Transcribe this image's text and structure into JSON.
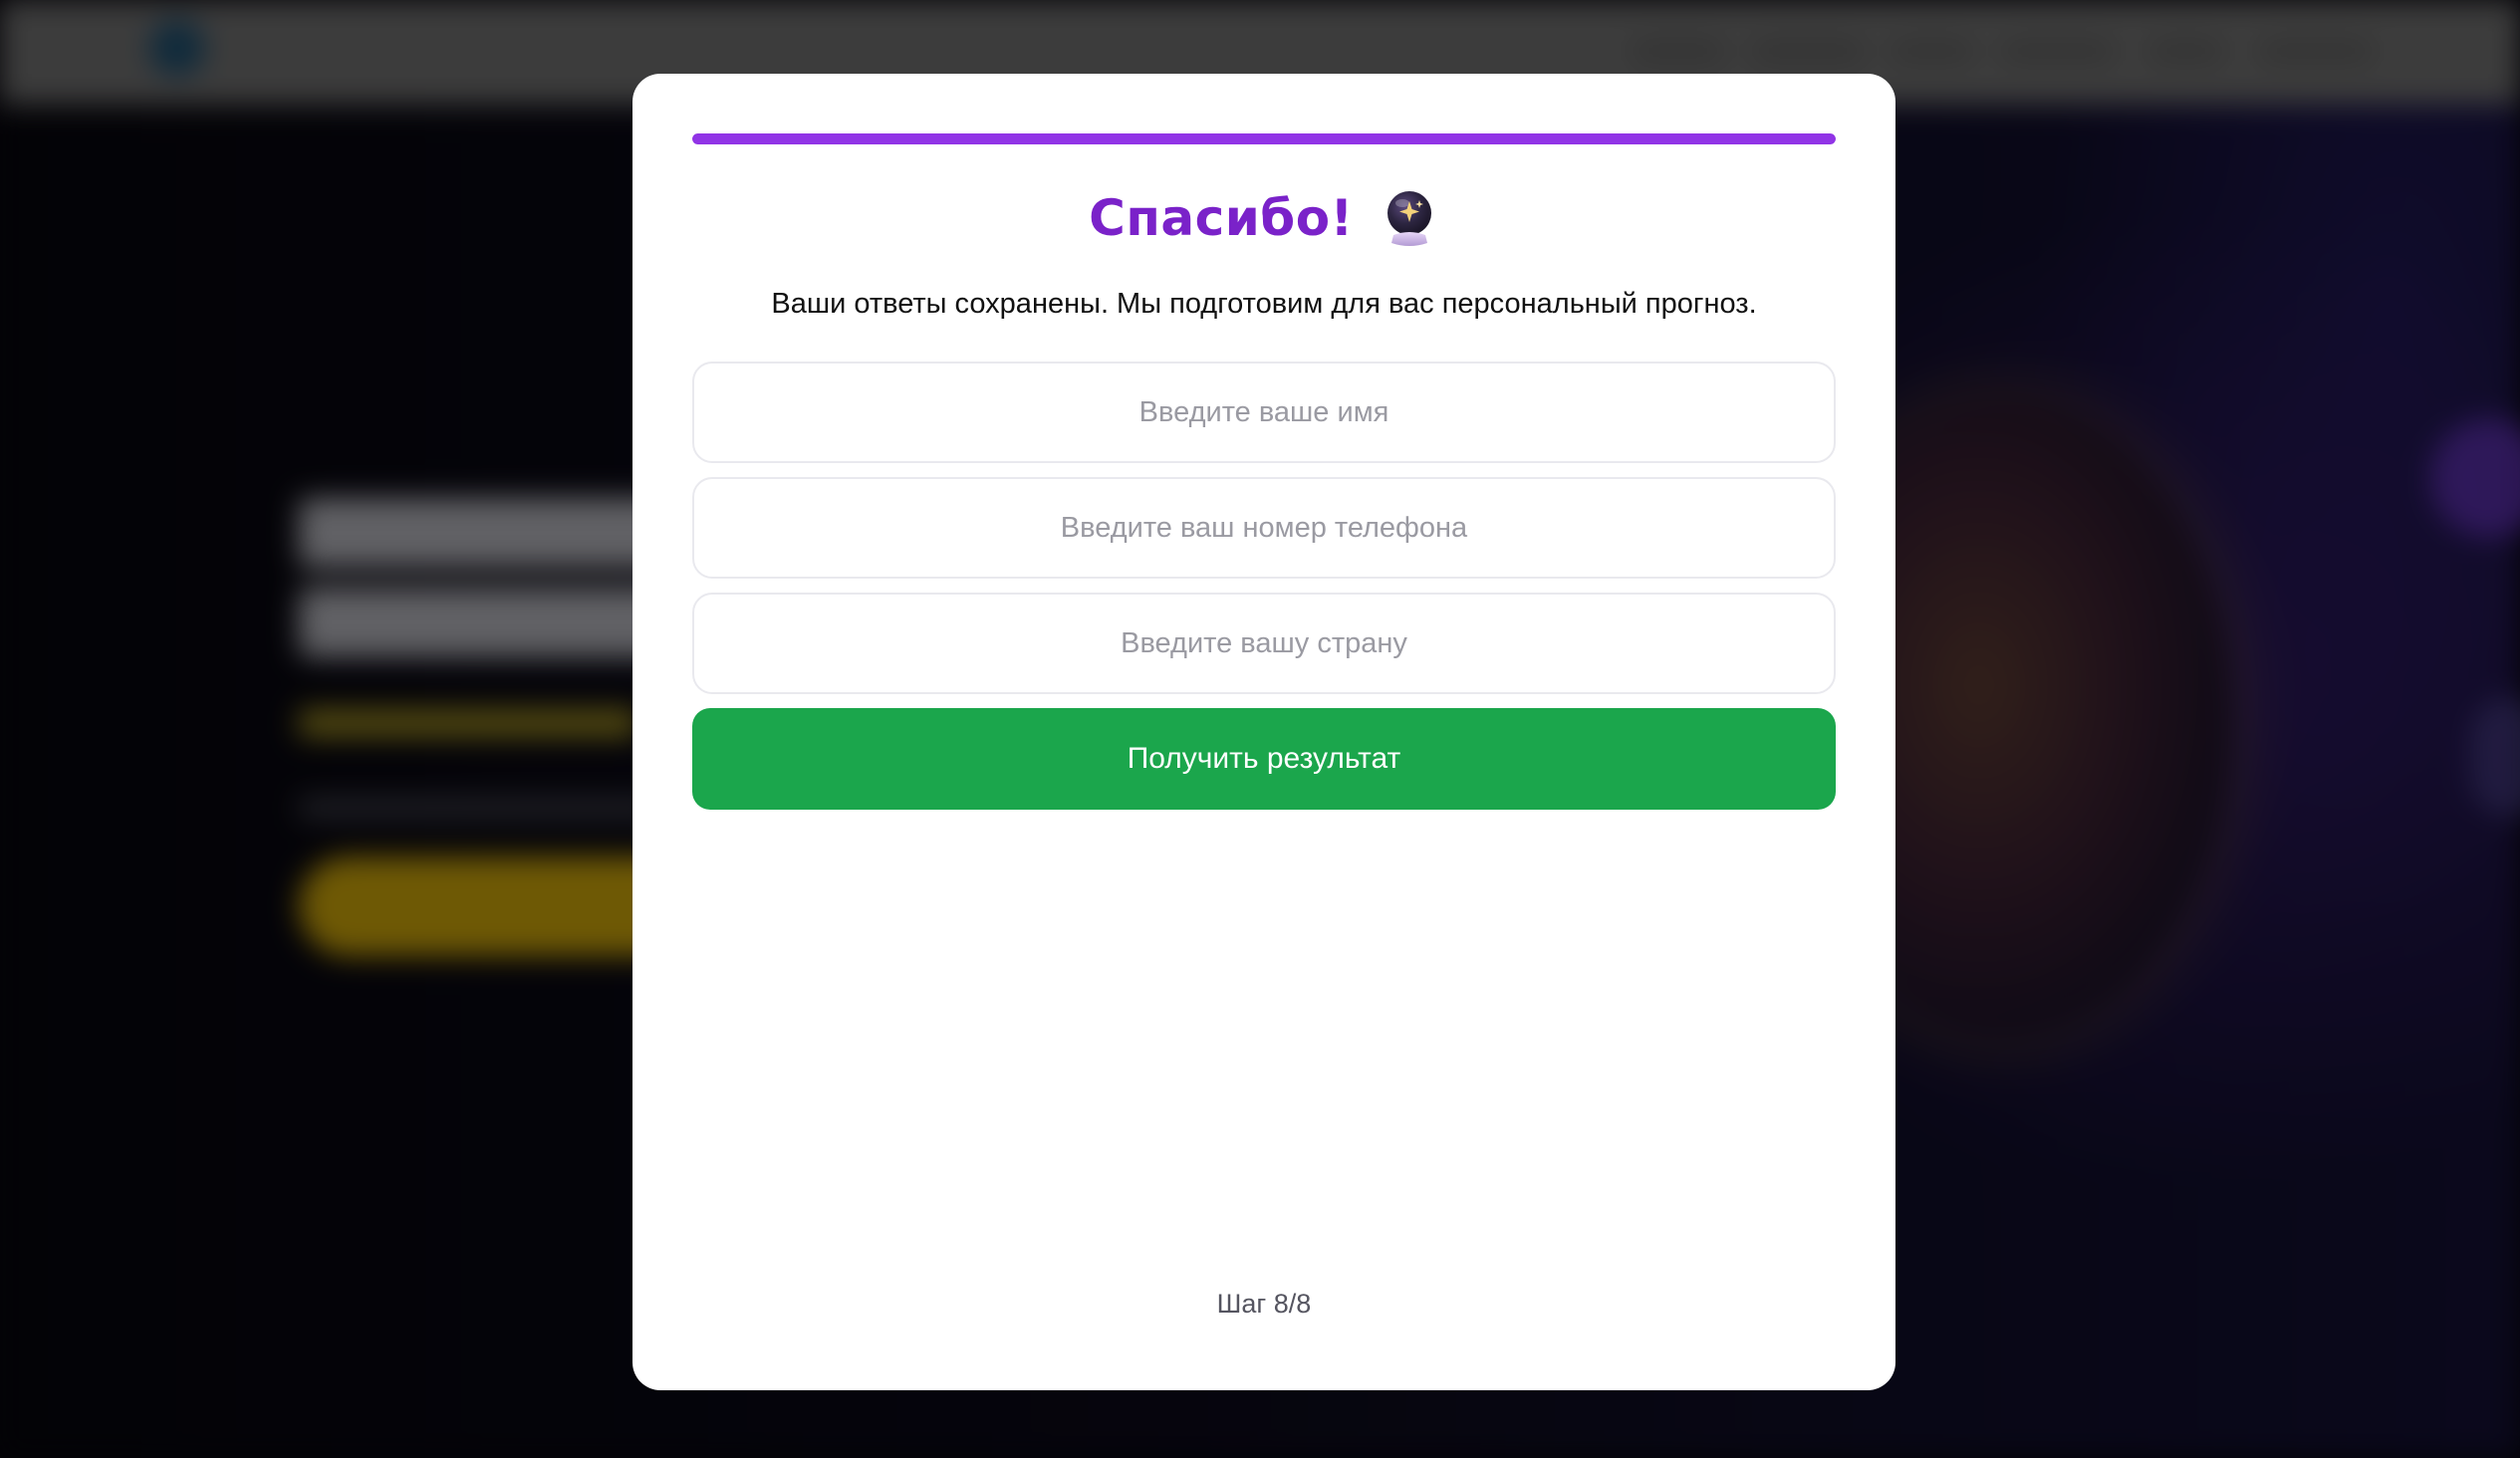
{
  "modal": {
    "progress_percent": 100,
    "title": "Спасибо!",
    "title_icon": "crystal-ball-icon",
    "subtitle": "Ваши ответы сохранены. Мы подготовим для вас персональный прогноз.",
    "fields": {
      "name": {
        "placeholder": "Введите ваше имя",
        "value": ""
      },
      "phone": {
        "placeholder": "Введите ваш номер телефона",
        "value": ""
      },
      "country": {
        "placeholder": "Введите вашу страну",
        "value": ""
      }
    },
    "submit_label": "Получить результат",
    "step_text": "Шаг 8/8"
  },
  "colors": {
    "accent": "#9134e6",
    "title": "#7a22c9",
    "button": "#1ba64c"
  }
}
